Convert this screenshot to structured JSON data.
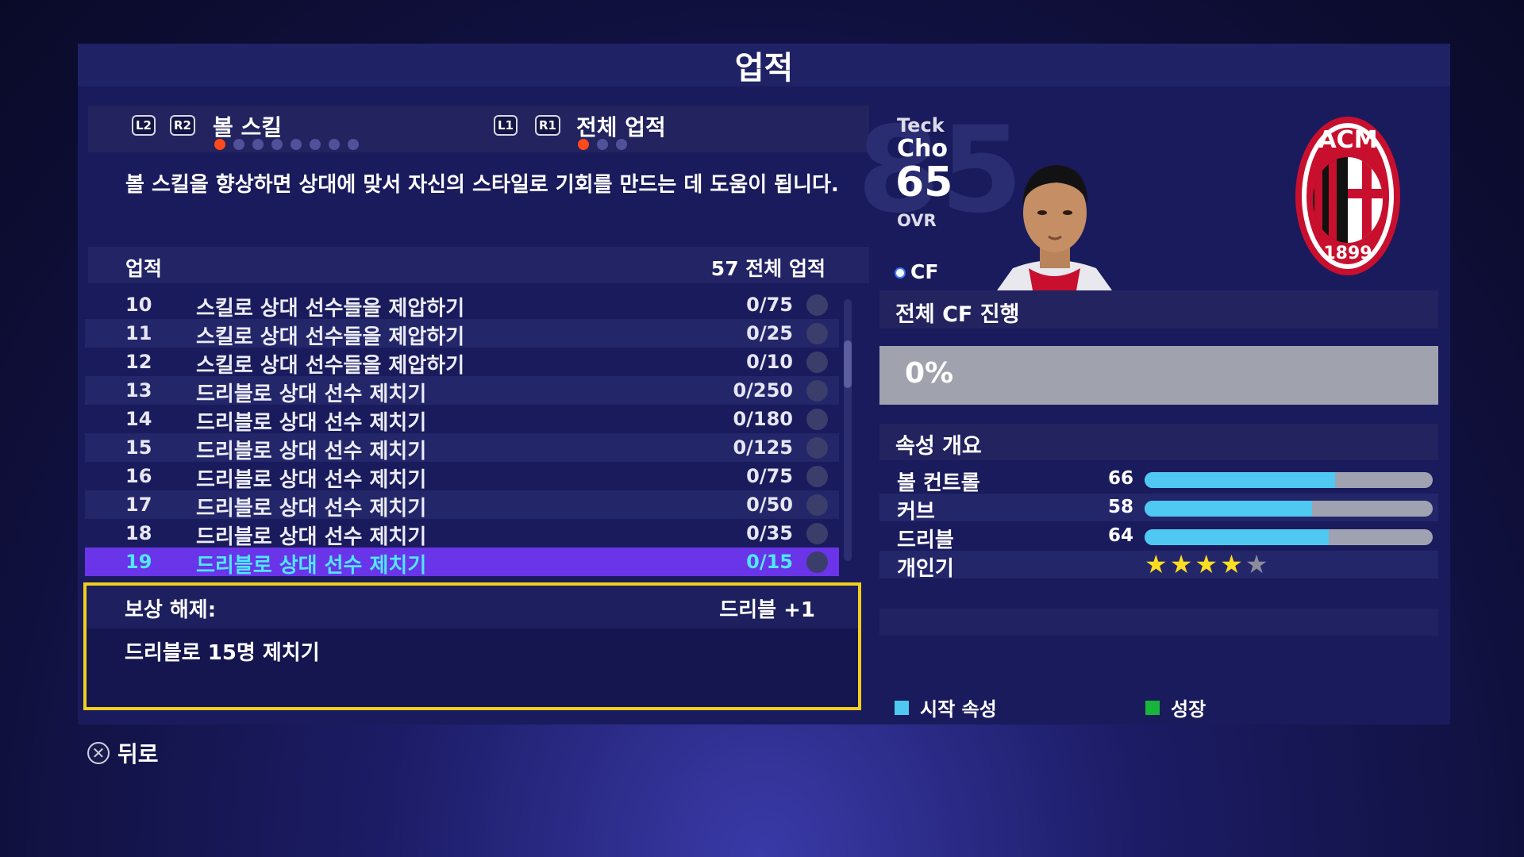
{
  "screen_title": "업적",
  "tabs": {
    "left_buttons": [
      "L2",
      "R2"
    ],
    "left_label": "볼 스킬",
    "left_dot_count": 8,
    "left_active_dot": 0,
    "right_buttons": [
      "L1",
      "R1"
    ],
    "right_label": "전체 업적",
    "right_dot_count": 3,
    "right_active_dot": 0
  },
  "description": "볼 스킬을 향상하면 상대에 맞서 자신의 스타일로 기회를 만드는 데 도움이 됩니다.",
  "list_header": {
    "left": "업적",
    "right": "57 전체 업적"
  },
  "achievements": [
    {
      "num": "10",
      "name": "스킬로 상대 선수들을 제압하기",
      "progress": "0/75"
    },
    {
      "num": "11",
      "name": "스킬로 상대 선수들을 제압하기",
      "progress": "0/25"
    },
    {
      "num": "12",
      "name": "스킬로 상대 선수들을 제압하기",
      "progress": "0/10"
    },
    {
      "num": "13",
      "name": "드리블로 상대 선수 제치기",
      "progress": "0/250"
    },
    {
      "num": "14",
      "name": "드리블로 상대 선수 제치기",
      "progress": "0/180"
    },
    {
      "num": "15",
      "name": "드리블로 상대 선수 제치기",
      "progress": "0/125"
    },
    {
      "num": "16",
      "name": "드리블로 상대 선수 제치기",
      "progress": "0/75"
    },
    {
      "num": "17",
      "name": "드리블로 상대 선수 제치기",
      "progress": "0/50"
    },
    {
      "num": "18",
      "name": "드리블로 상대 선수 제치기",
      "progress": "0/35"
    },
    {
      "num": "19",
      "name": "드리블로 상대 선수 제치기",
      "progress": "0/15"
    }
  ],
  "selected_index": 9,
  "reward": {
    "label": "보상 해제:",
    "value": "드리블 +1",
    "description": "드리블로 15명 제치기"
  },
  "player": {
    "first_name": "Teck",
    "last_name": "Cho",
    "ovr": "65",
    "ovr_label": "OVR",
    "rating_background": "85",
    "position": "CF"
  },
  "club_badge": {
    "letters": "ACM",
    "year": "1899"
  },
  "progress_section": {
    "title": "전체 CF 진행",
    "value_text": "0%",
    "fraction": 0
  },
  "attributes_section": {
    "title": "속성 개요",
    "attributes": [
      {
        "name": "볼 컨트롤",
        "value": "66",
        "fraction": 0.66
      },
      {
        "name": "커브",
        "value": "58",
        "fraction": 0.58
      },
      {
        "name": "드리블",
        "value": "64",
        "fraction": 0.64
      }
    ],
    "popularity": {
      "name": "개인기",
      "stars": 4,
      "max_stars": 5
    }
  },
  "legend": {
    "start_label": "시작 속성",
    "start_color": "#4fc8f2",
    "growth_label": "성장",
    "growth_color": "#17b53a"
  },
  "back": {
    "label": "뒤로",
    "icon": "cross-button-icon"
  },
  "colors": {
    "selected_row": "#6a34e8",
    "highlight_text": "#4ee8ff",
    "reward_border": "#f2cf1c",
    "active_dot": "#ff4a1c"
  }
}
